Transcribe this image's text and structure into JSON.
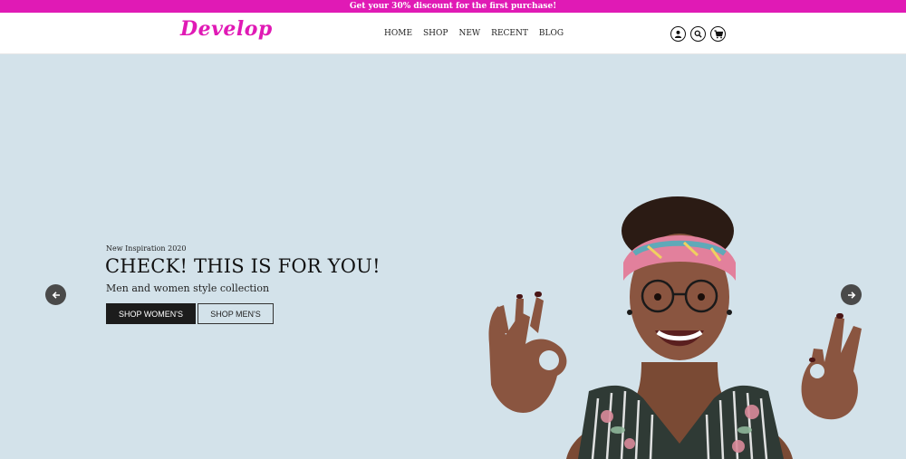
{
  "promo": {
    "text": "Get your 30% discount for the first purchase!"
  },
  "header": {
    "logo": "Develop",
    "nav": [
      "HOME",
      "SHOP",
      "NEW",
      "RECENT",
      "BLOG"
    ]
  },
  "hero": {
    "kicker": "New Inspiration 2020",
    "title": "CHECK! THIS IS FOR YOU!",
    "subtitle": "Men and women style collection",
    "primary_button": "SHOP WOMEN'S",
    "secondary_button": "SHOP MEN'S"
  },
  "icons": {
    "account": "user-icon",
    "search": "search-icon",
    "cart": "cart-icon",
    "prev": "arrow-left-icon",
    "next": "arrow-right-icon"
  },
  "colors": {
    "brand": "#e01ab5",
    "hero_background": "#d3e2ea",
    "primary_button": "#1c1c1c",
    "arrow": "#4a4a4a"
  }
}
